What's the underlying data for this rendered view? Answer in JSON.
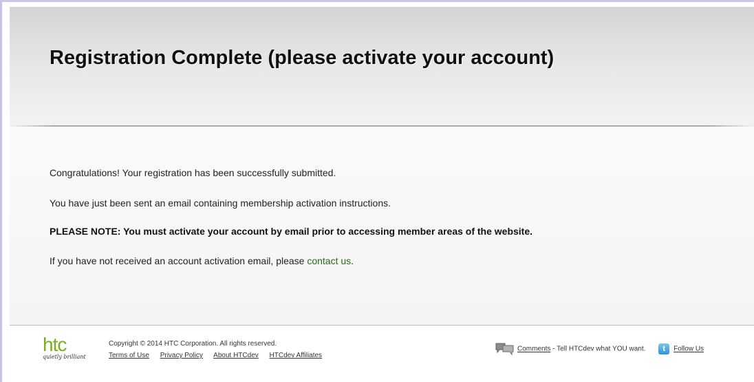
{
  "header": {
    "title": "Registration Complete (please activate your account)"
  },
  "content": {
    "line1": "Congratulations! Your registration has been successfully submitted.",
    "line2": "You have just been sent an email containing membership activation instructions.",
    "note": "PLEASE NOTE: You must activate your account by email prior to accessing member areas of the website.",
    "line4_prefix": "If you have not received an account activation email, please ",
    "contact_link": "contact us",
    "line4_suffix": "."
  },
  "footer": {
    "logo": {
      "mark": "htc",
      "tagline": "quietly brilliant"
    },
    "copyright": "Copyright © 2014 HTC Corporation. All rights reserved.",
    "links": [
      "Terms of Use",
      "Privacy Policy",
      "About HTCdev",
      "HTCdev Affiliates"
    ],
    "comments_link": "Comments",
    "comments_text": " - Tell HTCdev what YOU want.",
    "follow_link": "Follow Us",
    "icons": {
      "comments": "speech-bubbles-icon",
      "follow": "twitter-icon"
    },
    "colors": {
      "logo_green": "#77b01a",
      "link_green": "#2d6a14",
      "twitter_blue": "#2d95d4"
    }
  }
}
